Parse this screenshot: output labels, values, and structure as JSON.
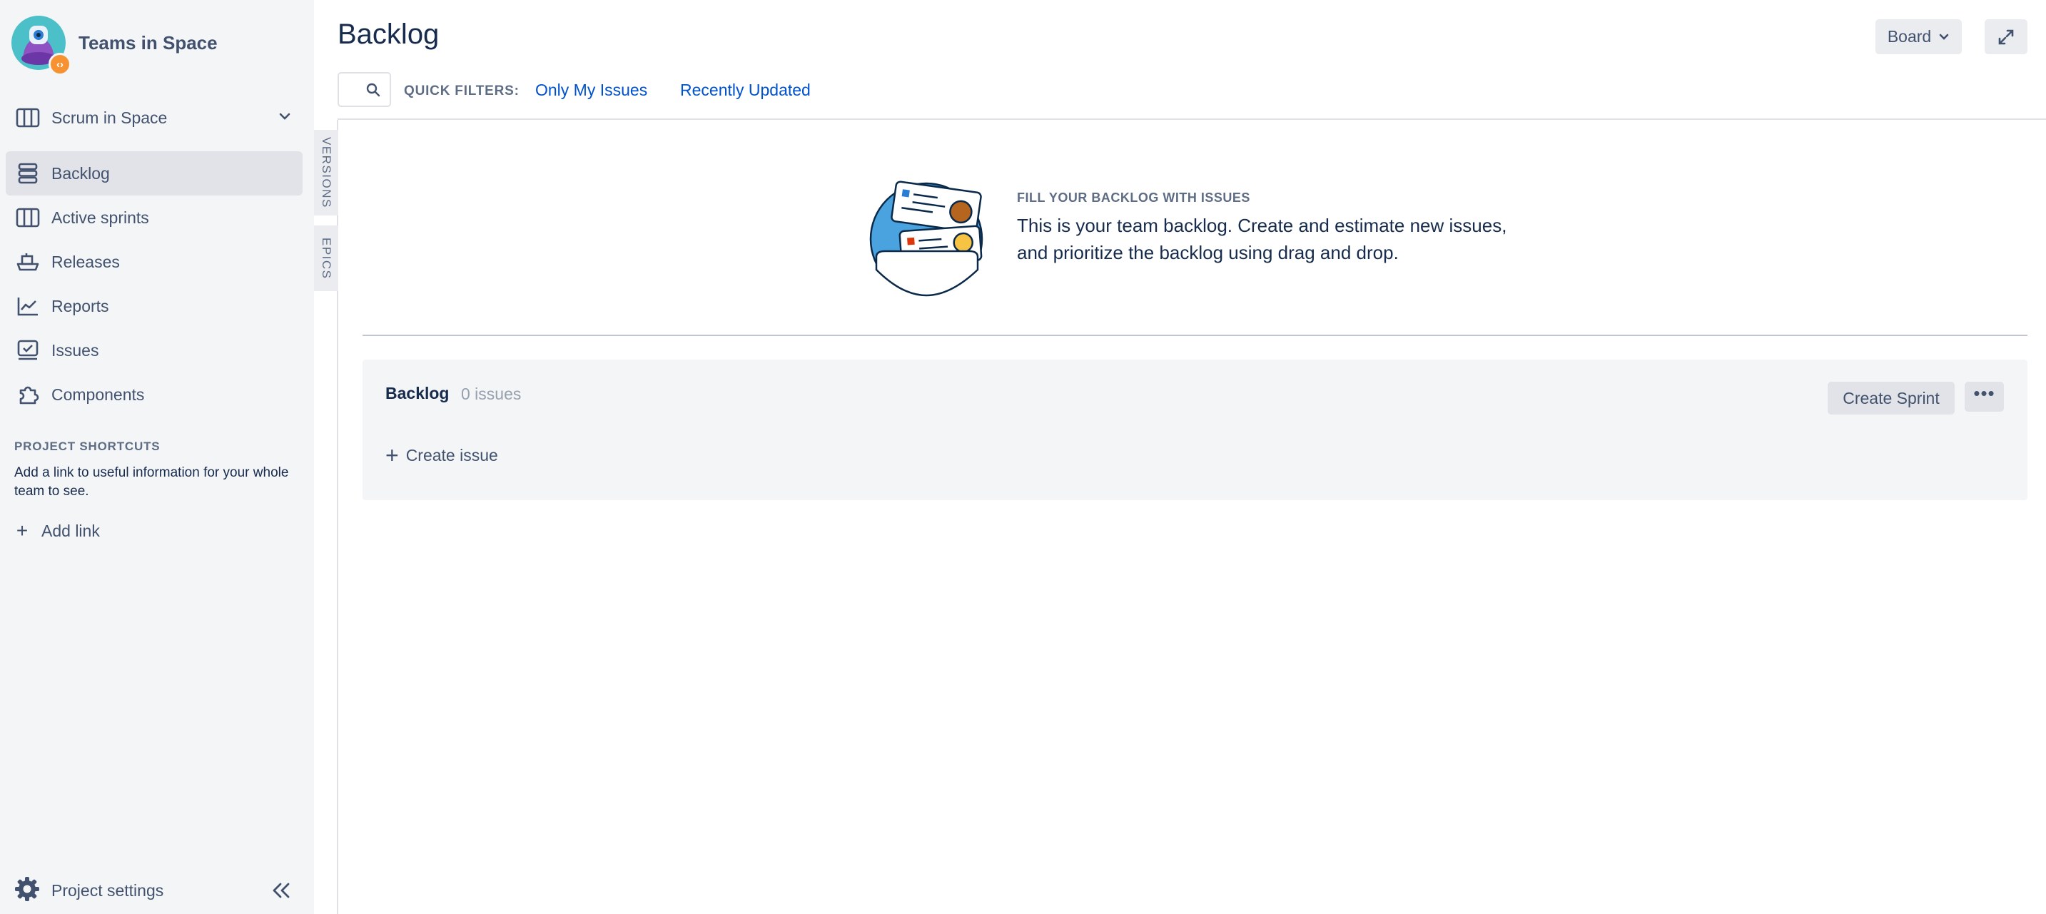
{
  "sidebar": {
    "project_name": "Teams in Space",
    "board_name": "Scrum in Space",
    "nav": [
      {
        "label": "Backlog",
        "icon": "backlog-icon",
        "active": true
      },
      {
        "label": "Active sprints",
        "icon": "board-icon",
        "active": false
      },
      {
        "label": "Releases",
        "icon": "ship-icon",
        "active": false
      },
      {
        "label": "Reports",
        "icon": "chart-icon",
        "active": false
      },
      {
        "label": "Issues",
        "icon": "issues-icon",
        "active": false
      },
      {
        "label": "Components",
        "icon": "puzzle-icon",
        "active": false
      }
    ],
    "shortcuts_title": "PROJECT SHORTCUTS",
    "shortcuts_desc": "Add a link to useful information for your whole team to see.",
    "add_link": "Add link",
    "settings": "Project settings"
  },
  "side_tabs": {
    "versions": "VERSIONS",
    "epics": "EPICS"
  },
  "header": {
    "title": "Backlog",
    "board_button": "Board",
    "quick_filters_label": "QUICK FILTERS:",
    "filters": [
      "Only My Issues",
      "Recently Updated"
    ]
  },
  "empty_state": {
    "title": "FILL YOUR BACKLOG WITH ISSUES",
    "text": "This is your team backlog. Create and estimate new issues, and prioritize the backlog using drag and drop."
  },
  "backlog": {
    "title": "Backlog",
    "count": "0 issues",
    "create_sprint": "Create Sprint",
    "more": "•••",
    "create_issue": "Create issue"
  },
  "colors": {
    "sidebar_bg": "#f4f5f7",
    "link": "#0052cc",
    "text": "#172b4d",
    "muted": "#42526e",
    "badge": "#f79232"
  }
}
